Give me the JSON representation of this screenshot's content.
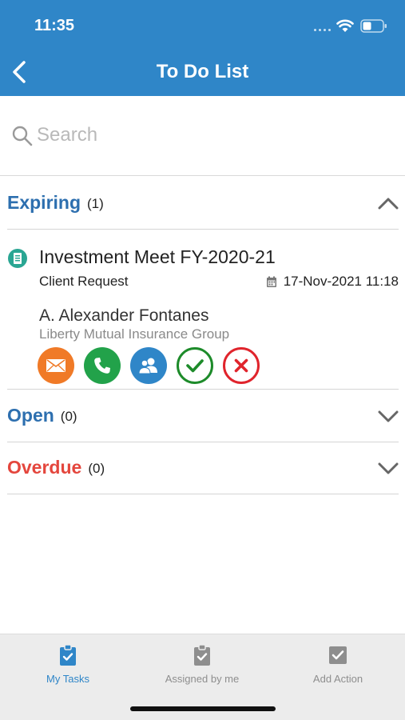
{
  "status_bar": {
    "time": "11:35"
  },
  "header": {
    "title": "To Do List"
  },
  "search": {
    "placeholder": "Search",
    "value": ""
  },
  "sections": {
    "expiring": {
      "label": "Expiring",
      "count": "(1)",
      "color": "#2d6faf"
    },
    "open": {
      "label": "Open",
      "count": "(0)",
      "color": "#2d6faf"
    },
    "overdue": {
      "label": "Overdue",
      "count": "(0)",
      "color": "#e4463d"
    }
  },
  "task": {
    "title": "Investment Meet FY-2020-21",
    "category": "Client Request",
    "date": "17-Nov-2021 11:18",
    "contact": "A. Alexander Fontanes",
    "company": "Liberty Mutual Insurance Group",
    "actions": [
      {
        "icon": "envelope-icon",
        "color": "#f07a27"
      },
      {
        "icon": "phone-icon",
        "color": "#22a24a"
      },
      {
        "icon": "people-icon",
        "color": "#2f86c8"
      },
      {
        "icon": "check-icon",
        "color": "#1d8b2a"
      },
      {
        "icon": "close-icon",
        "color": "#e0242c"
      }
    ]
  },
  "tabbar": {
    "tabs": [
      {
        "label": "My Tasks",
        "active": true,
        "color": "#2f86c8"
      },
      {
        "label": "Assigned by me",
        "active": false,
        "color": "#8e8e8e"
      },
      {
        "label": "Add Action",
        "active": false,
        "color": "#8e8e8e"
      }
    ]
  }
}
